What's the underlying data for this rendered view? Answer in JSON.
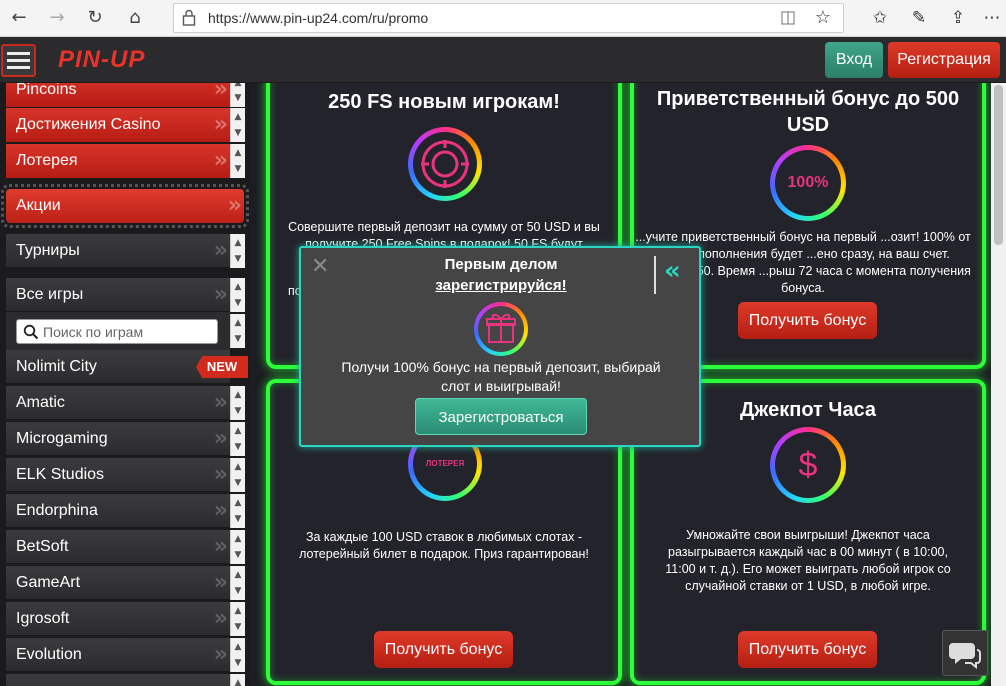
{
  "browser": {
    "url": "https://www.pin-up24.com/ru/promo",
    "back_icon": "arrow-left-icon",
    "forward_icon": "arrow-right-icon",
    "refresh_icon": "refresh-icon",
    "home_icon": "home-icon"
  },
  "header": {
    "logo": "PIN-UP",
    "login_label": "Вход",
    "register_label": "Регистрация"
  },
  "sidebar": {
    "top_items": [
      {
        "label": "Pincoins"
      },
      {
        "label": "Достижения Casino"
      },
      {
        "label": "Лотерея"
      }
    ],
    "active_item": "Акции",
    "tournaments": "Турниры",
    "all_games": "Все игры",
    "search_placeholder": "Поиск по играм",
    "providers": [
      {
        "label": "Nolimit City",
        "badge": "NEW"
      },
      {
        "label": "Amatic"
      },
      {
        "label": "Microgaming"
      },
      {
        "label": "ELK Studios"
      },
      {
        "label": "Endorphina"
      },
      {
        "label": "BetSoft"
      },
      {
        "label": "GameArt"
      },
      {
        "label": "Igrosoft"
      },
      {
        "label": "Evolution"
      }
    ]
  },
  "cards": [
    {
      "title": "250 FS новым игрокам!",
      "text": "Совершите первый депозит на сумму от 50 USD и вы получите 250 Free Spins в подарок! 50 FS будут"
    },
    {
      "title": "Приветственный бонус до 500 USD",
      "icon_label": "100%",
      "text": "...учите приветственный бонус на первый ...озит! 100% от суммы пополнения будет ...ено сразу, на ваш счет. Вейджер х50. Время ...рыш 72 часа с момента получения бонуса.",
      "button": "Получить бонус"
    },
    {
      "title": "",
      "icon_label": "ЛОТЕРЕЯ",
      "text": "За каждые 100 USD ставок в любимых слотах - лотерейный билет в подарок. Приз гарантирован!",
      "button": "Получить бонус"
    },
    {
      "title": "Джекпот Часа",
      "icon_label": "$",
      "text": "Умножайте свои выигрыши! Джекпот часа разыгрывается каждый час в 00 минут ( в 10:00, 11:00 и т. д.). Его может выиграть любой игрок со случайной ставки от 1 USD, в любой игре.",
      "button": "Получить бонус"
    }
  ],
  "modal": {
    "title_line1": "Первым делом",
    "title_line2": "зарегистрируйся!",
    "text": "Получи 100% бонус на первый депозит, выбирай слот и выигрывай!",
    "button": "Зарегистроваться",
    "partial_text_left": "по"
  },
  "colors": {
    "neon_green": "#2cff3a",
    "accent_red": "#d9352a",
    "accent_teal": "#2ad6c1"
  }
}
